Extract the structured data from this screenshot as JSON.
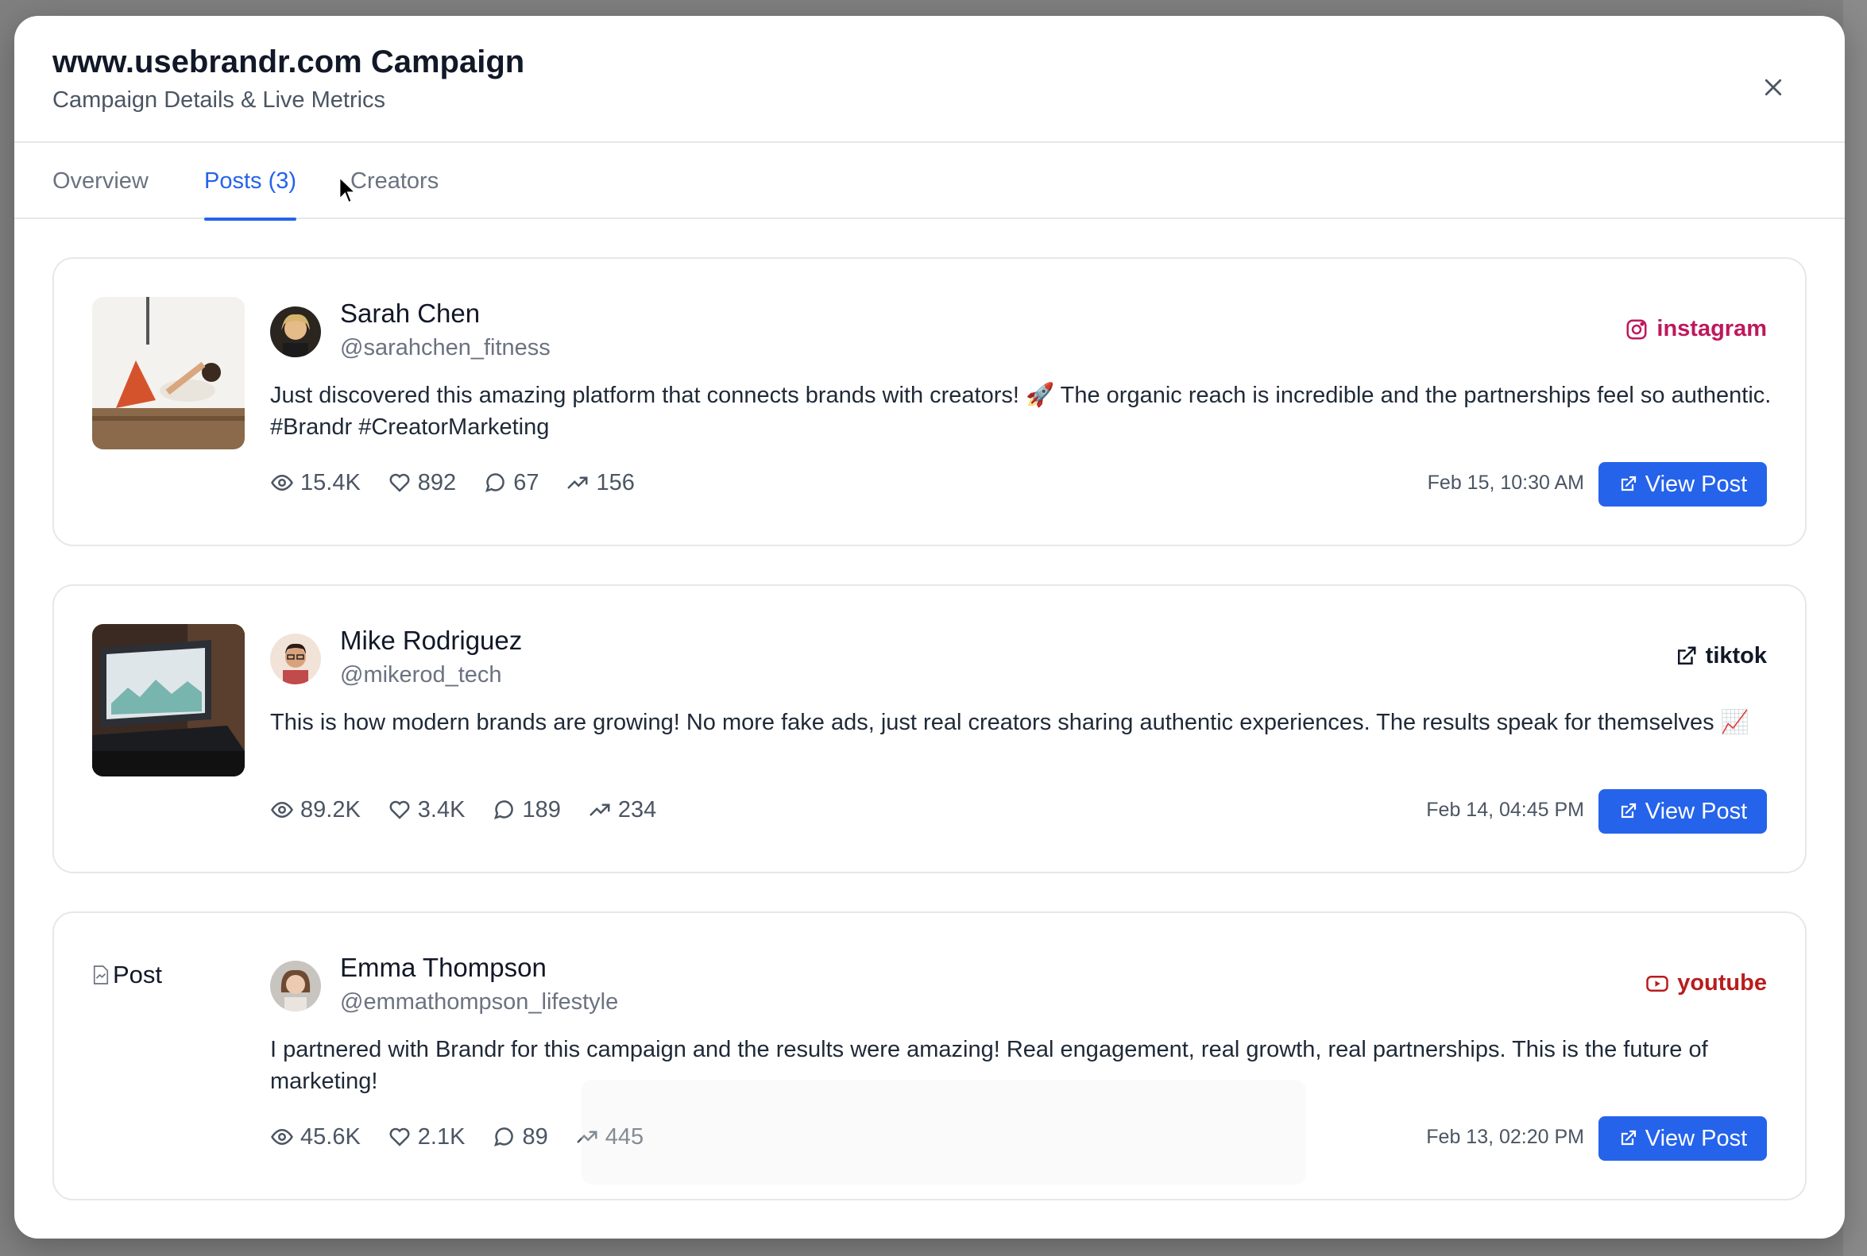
{
  "modal": {
    "title": "www.usebrandr.com Campaign",
    "subtitle": "Campaign Details & Live Metrics",
    "close_icon": "close-icon"
  },
  "tabs": [
    {
      "label": "Overview",
      "active": false
    },
    {
      "label": "Posts (3)",
      "active": true
    },
    {
      "label": "Creators",
      "active": false
    }
  ],
  "posts": [
    {
      "author": "Sarah Chen",
      "handle": "@sarahchen_fitness",
      "platform": "instagram",
      "platform_icon": "instagram-icon",
      "platform_color": "#be185d",
      "text": "Just discovered this amazing platform that connects brands with creators! 🚀 The organic reach is incredible and the partnerships feel so authentic. #Brandr #CreatorMarketing",
      "views": "15.4K",
      "likes": "892",
      "comments": "67",
      "shares": "156",
      "date": "Feb 15, 10:30 AM",
      "button": "View Post"
    },
    {
      "author": "Mike Rodriguez",
      "handle": "@mikerod_tech",
      "platform": "tiktok",
      "platform_icon": "external-link-icon",
      "platform_color": "#111827",
      "text": "This is how modern brands are growing! No more fake ads, just real creators sharing authentic experiences. The results speak for themselves 📈",
      "views": "89.2K",
      "likes": "3.4K",
      "comments": "189",
      "shares": "234",
      "date": "Feb 14, 04:45 PM",
      "button": "View Post"
    },
    {
      "author": "Emma Thompson",
      "handle": "@emmathompson_lifestyle",
      "platform": "youtube",
      "platform_icon": "youtube-icon",
      "platform_color": "#b91c1c",
      "image_alt": "Post",
      "text": "I partnered with Brandr for this campaign and the results were amazing! Real engagement, real growth, real partnerships. This is the future of marketing!",
      "views": "45.6K",
      "likes": "2.1K",
      "comments": "89",
      "shares": "445",
      "date": "Feb 13, 02:20 PM",
      "button": "View Post"
    }
  ],
  "colors": {
    "accent": "#2563eb",
    "backdrop": "#7f7f7f"
  }
}
